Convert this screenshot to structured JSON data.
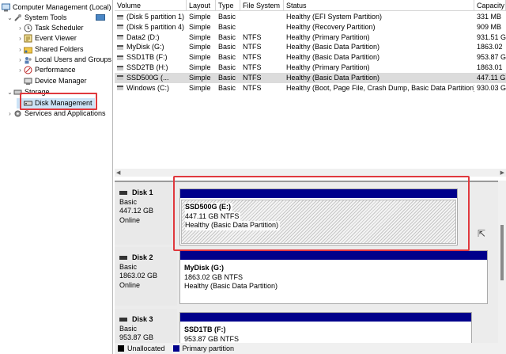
{
  "tree": {
    "root": "Computer Management (Local)",
    "items": [
      {
        "label": "System Tools",
        "icon": "tools-icon",
        "level": 1,
        "chevron": "v"
      },
      {
        "label": "Task Scheduler",
        "icon": "clock-icon",
        "level": 2,
        "chevron": ">"
      },
      {
        "label": "Event Viewer",
        "icon": "event-viewer-icon",
        "level": 2,
        "chevron": ">"
      },
      {
        "label": "Shared Folders",
        "icon": "shared-folder-icon",
        "level": 2,
        "chevron": ">"
      },
      {
        "label": "Local Users and Groups",
        "icon": "users-icon",
        "level": 2,
        "chevron": ">"
      },
      {
        "label": "Performance",
        "icon": "performance-icon",
        "level": 2,
        "chevron": ">"
      },
      {
        "label": "Device Manager",
        "icon": "device-manager-icon",
        "level": 2,
        "chevron": ""
      },
      {
        "label": "Storage",
        "icon": "storage-icon",
        "level": 1,
        "chevron": "v"
      },
      {
        "label": "Disk Management",
        "icon": "disk-icon",
        "level": 2,
        "chevron": ""
      },
      {
        "label": "Services and Applications",
        "icon": "services-icon",
        "level": 1,
        "chevron": ">"
      }
    ]
  },
  "volume_list": {
    "columns": [
      "Volume",
      "Layout",
      "Type",
      "File System",
      "Status",
      "Capacity"
    ],
    "rows": [
      [
        "(Disk 5 partition 1)",
        "Simple",
        "Basic",
        "",
        "Healthy (EFI System Partition)",
        "331 MB"
      ],
      [
        "(Disk 5 partition 4)",
        "Simple",
        "Basic",
        "",
        "Healthy (Recovery Partition)",
        "909 MB"
      ],
      [
        "Data2 (D:)",
        "Simple",
        "Basic",
        "NTFS",
        "Healthy (Primary Partition)",
        "931.51 G"
      ],
      [
        "MyDisk (G:)",
        "Simple",
        "Basic",
        "NTFS",
        "Healthy (Basic Data Partition)",
        "1863.02"
      ],
      [
        "SSD1TB (F:)",
        "Simple",
        "Basic",
        "NTFS",
        "Healthy (Basic Data Partition)",
        "953.87 G"
      ],
      [
        "SSD2TB (H:)",
        "Simple",
        "Basic",
        "NTFS",
        "Healthy (Primary Partition)",
        "1863.01"
      ],
      [
        "SSD500G (...",
        "Simple",
        "Basic",
        "NTFS",
        "Healthy (Basic Data Partition)",
        "447.11 G"
      ],
      [
        "Windows (C:)",
        "Simple",
        "Basic",
        "NTFS",
        "Healthy (Boot, Page File, Crash Dump, Basic Data Partition)",
        "930.03 G"
      ]
    ],
    "selected_row": 6
  },
  "disks": [
    {
      "title": "Disk 1",
      "type": "Basic",
      "size": "447.12 GB",
      "status": "Online",
      "partition": {
        "name": "SSD500G  (E:)",
        "size": "447.11 GB NTFS",
        "status": "Healthy (Basic Data Partition)"
      }
    },
    {
      "title": "Disk 2",
      "type": "Basic",
      "size": "1863.02 GB",
      "status": "Online",
      "partition": {
        "name": "MyDisk  (G:)",
        "size": "1863.02 GB NTFS",
        "status": "Healthy (Basic Data Partition)"
      }
    },
    {
      "title": "Disk 3",
      "type": "Basic",
      "size": "953.87 GB",
      "status": "",
      "partition": {
        "name": "SSD1TB  (F:)",
        "size": "953.87 GB NTFS",
        "status": ""
      }
    }
  ],
  "legend": [
    {
      "label": "Unallocated",
      "color": "#000000"
    },
    {
      "label": "Primary partition",
      "color": "#00008b"
    }
  ],
  "colors": {
    "primary_bar": "#00008b",
    "highlight": "#e0393e"
  }
}
